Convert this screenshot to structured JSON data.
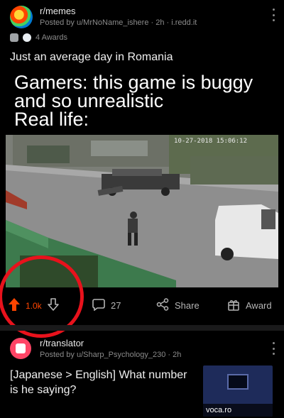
{
  "post": {
    "subreddit": "r/memes",
    "posted_by": "Posted by u/MrNoName_ishere · 2h · i.redd.it",
    "awards": "4 Awards",
    "title": "Just an average day in Romania",
    "caption": "Gamers: this game is buggy\nand so unrealistic\nReal life:",
    "video_timestamp": "10-27-2018 15:06:12",
    "votes": "1.0k",
    "comments": "27",
    "share_label": "Share",
    "award_label": "Award"
  },
  "next_post": {
    "subreddit": "r/translator",
    "posted_by": "Posted by u/Sharp_Psychology_230 · 2h",
    "title": "[Japanese > English] What number is he saying?",
    "thumb_domain": "voca.ro"
  },
  "colors": {
    "upvote": "#ff4500",
    "highlight_circle": "#e8121c",
    "background": "#000000"
  }
}
